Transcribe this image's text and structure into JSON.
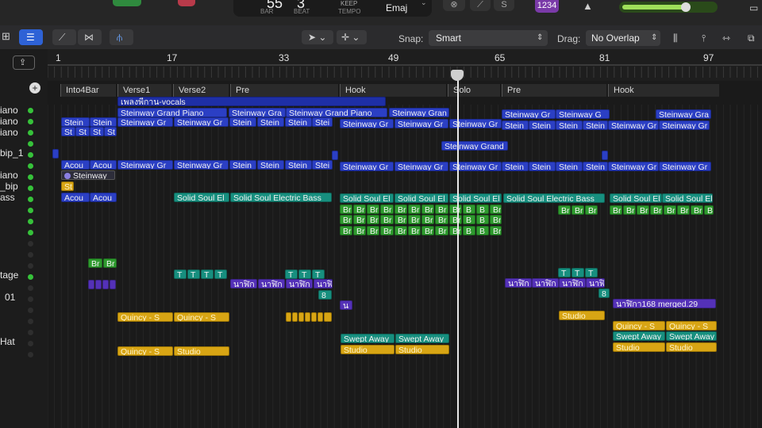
{
  "transport": {
    "bar_value": "55",
    "bar_label": "BAR",
    "beat_value": "3",
    "beat_label": "BEAT",
    "tempo_keep": "KEEP",
    "tempo_label": "TEMPO",
    "key": "Emaj",
    "count_in": "1234"
  },
  "toolbar": {
    "snap_label": "Snap:",
    "snap_value": "Smart",
    "drag_label": "Drag:",
    "drag_value": "No Overlap"
  },
  "ruler": {
    "bars": [
      "1",
      "17",
      "33",
      "49",
      "65",
      "81",
      "97"
    ]
  },
  "markers": [
    "Into4Bar",
    "Verse1",
    "Verse2",
    "Pre",
    "Hook",
    "Solo",
    "Pre",
    "Hook"
  ],
  "tracks": [
    "iano",
    "iano",
    "iano",
    "bip_1",
    "iano",
    "_bip",
    "ass",
    "tage",
    "01",
    "Hat"
  ],
  "regions": {
    "vocals": "เพลงพี่กาน-vocals",
    "sgp": "Steinway Grand Piano",
    "sg": "Steinway Gra",
    "sgr": "Steinway Gran",
    "sgr2": "Steinway Gr",
    "sg_short": "Steinway G",
    "stein": "Stein",
    "stei": "Stei",
    "st": "St",
    "sgrand": "Steinway Grand",
    "steinway": "Steinway",
    "acou": "Acou",
    "ssel": "Solid Soul El",
    "sseb": "Solid Soul Electric Bass",
    "ssel2": "Solid Soul El",
    "br": "Br",
    "b": "B",
    "t": "T",
    "thai": "นาฬิก",
    "eight": "8",
    "n": "น",
    "merged": "นาฬิกา168 merged.29",
    "quincy": "Quincy - S",
    "studio": "Studio",
    "swept": "Swept Away"
  }
}
